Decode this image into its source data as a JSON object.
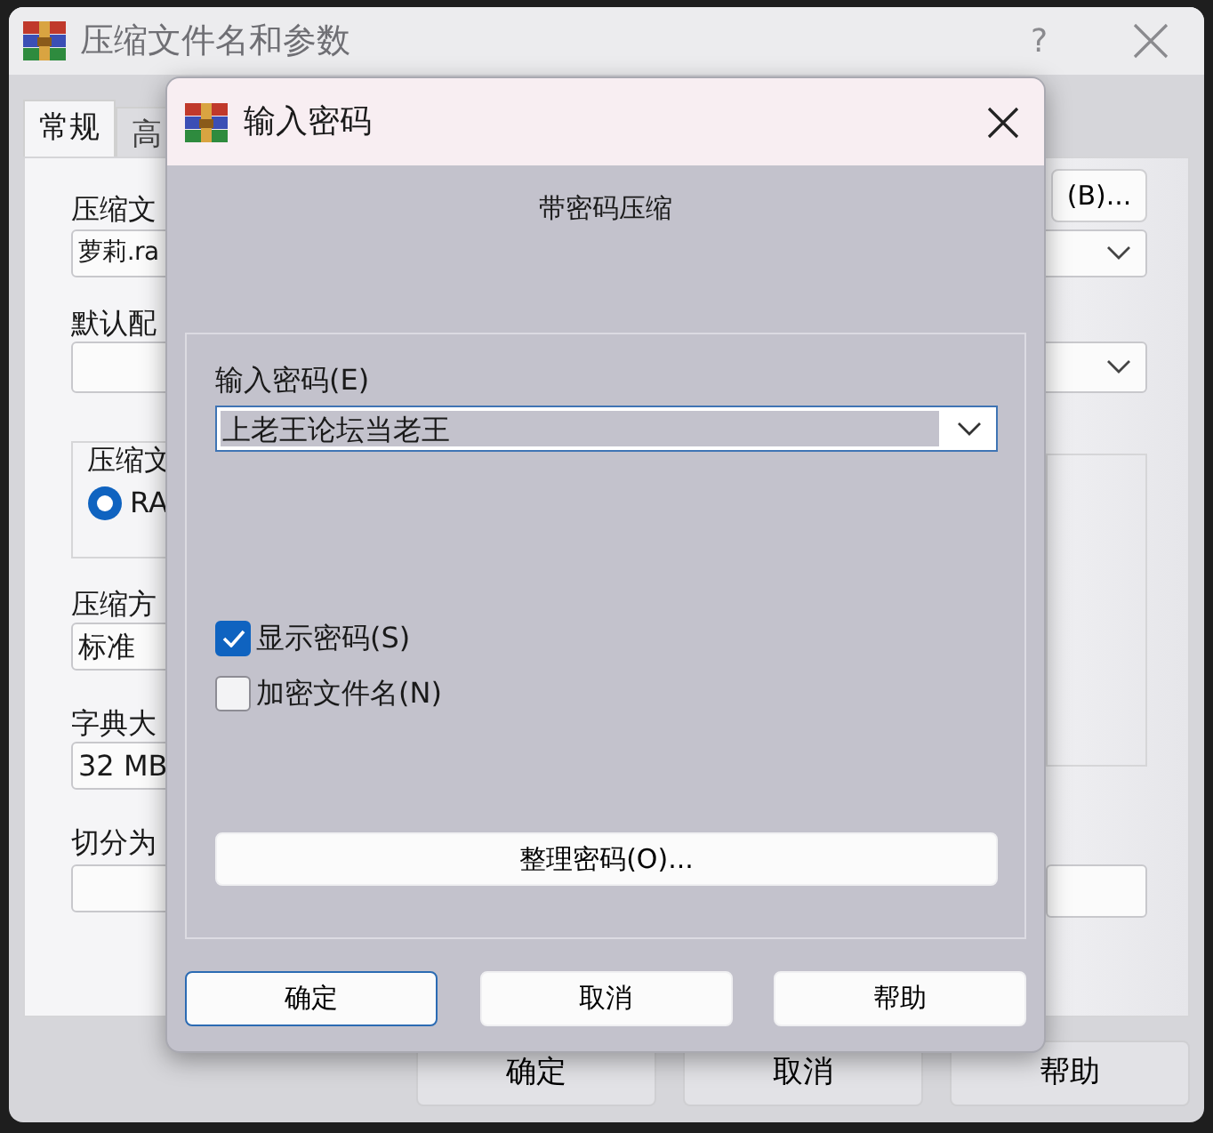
{
  "main_window": {
    "title": "压缩文件名和参数",
    "help_glyph": "?",
    "tabs": [
      {
        "label": "常规",
        "selected": true
      },
      {
        "label": "高",
        "selected": false
      }
    ],
    "archive_name_label": "压缩文",
    "browse_button": "(B)...",
    "archive_name_value": "萝莉.ra",
    "profile_label": "默认配",
    "format_group_label": "压缩文",
    "format_options": [
      {
        "label": "RA",
        "selected": true
      }
    ],
    "method_label": "压缩方",
    "method_value": "标准",
    "dictionary_label": "字典大",
    "dictionary_value": "32 MB",
    "split_label": "切分为",
    "buttons": [
      "确定",
      "取消",
      "帮助"
    ]
  },
  "password_dialog": {
    "title": "输入密码",
    "subtitle": "带密码压缩",
    "password_label": "输入密码(E)",
    "password_value": "上老王论坛当老王",
    "options": [
      {
        "label": "显示密码(S)",
        "checked": true
      },
      {
        "label": "加密文件名(N)",
        "checked": false
      }
    ],
    "organize_button": "整理密码(O)...",
    "buttons": [
      {
        "label": "确定",
        "default": true
      },
      {
        "label": "取消",
        "default": false
      },
      {
        "label": "帮助",
        "default": false
      }
    ]
  }
}
